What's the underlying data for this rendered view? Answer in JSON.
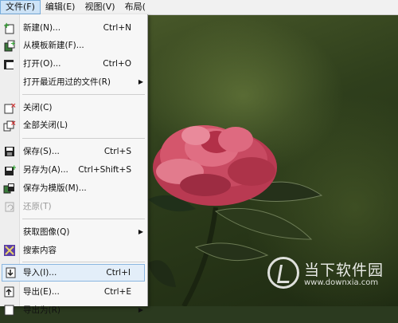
{
  "menubar": {
    "items": [
      "文件(F)",
      "编辑(E)",
      "视图(V)",
      "布局("
    ]
  },
  "file_menu": {
    "items": [
      {
        "label": "新建(N)...",
        "shortcut": "Ctrl+N",
        "icon": "new-document-icon"
      },
      {
        "label": "从模板新建(F)...",
        "shortcut": "",
        "icon": "new-from-template-icon"
      },
      {
        "label": "打开(O)...",
        "shortcut": "Ctrl+O",
        "icon": "open-folder-icon"
      },
      {
        "label": "打开最近用过的文件(R)",
        "shortcut": "",
        "icon": "",
        "submenu": true
      },
      {
        "label": "关闭(C)",
        "shortcut": "",
        "icon": "close-document-icon"
      },
      {
        "label": "全部关闭(L)",
        "shortcut": "",
        "icon": "close-all-icon"
      },
      {
        "label": "保存(S)...",
        "shortcut": "Ctrl+S",
        "icon": "save-icon"
      },
      {
        "label": "另存为(A)...",
        "shortcut": "Ctrl+Shift+S",
        "icon": "save-as-icon"
      },
      {
        "label": "保存为模版(M)...",
        "shortcut": "",
        "icon": "save-as-template-icon"
      },
      {
        "label": "还原(T)",
        "shortcut": "",
        "icon": "revert-icon",
        "disabled": true
      },
      {
        "label": "获取图像(Q)",
        "shortcut": "",
        "icon": "",
        "submenu": true
      },
      {
        "label": "搜索内容",
        "shortcut": "",
        "icon": "search-content-icon"
      },
      {
        "label": "导入(I)...",
        "shortcut": "Ctrl+I",
        "icon": "import-icon",
        "highlighted": true
      },
      {
        "label": "导出(E)...",
        "shortcut": "Ctrl+E",
        "icon": "export-icon"
      },
      {
        "label": "导出为(R)",
        "shortcut": "",
        "icon": "export-as-icon",
        "submenu": true
      }
    ],
    "submenu_arrow": "▶"
  },
  "watermark": {
    "title": "当下软件园",
    "url": "www.downxia.com"
  }
}
